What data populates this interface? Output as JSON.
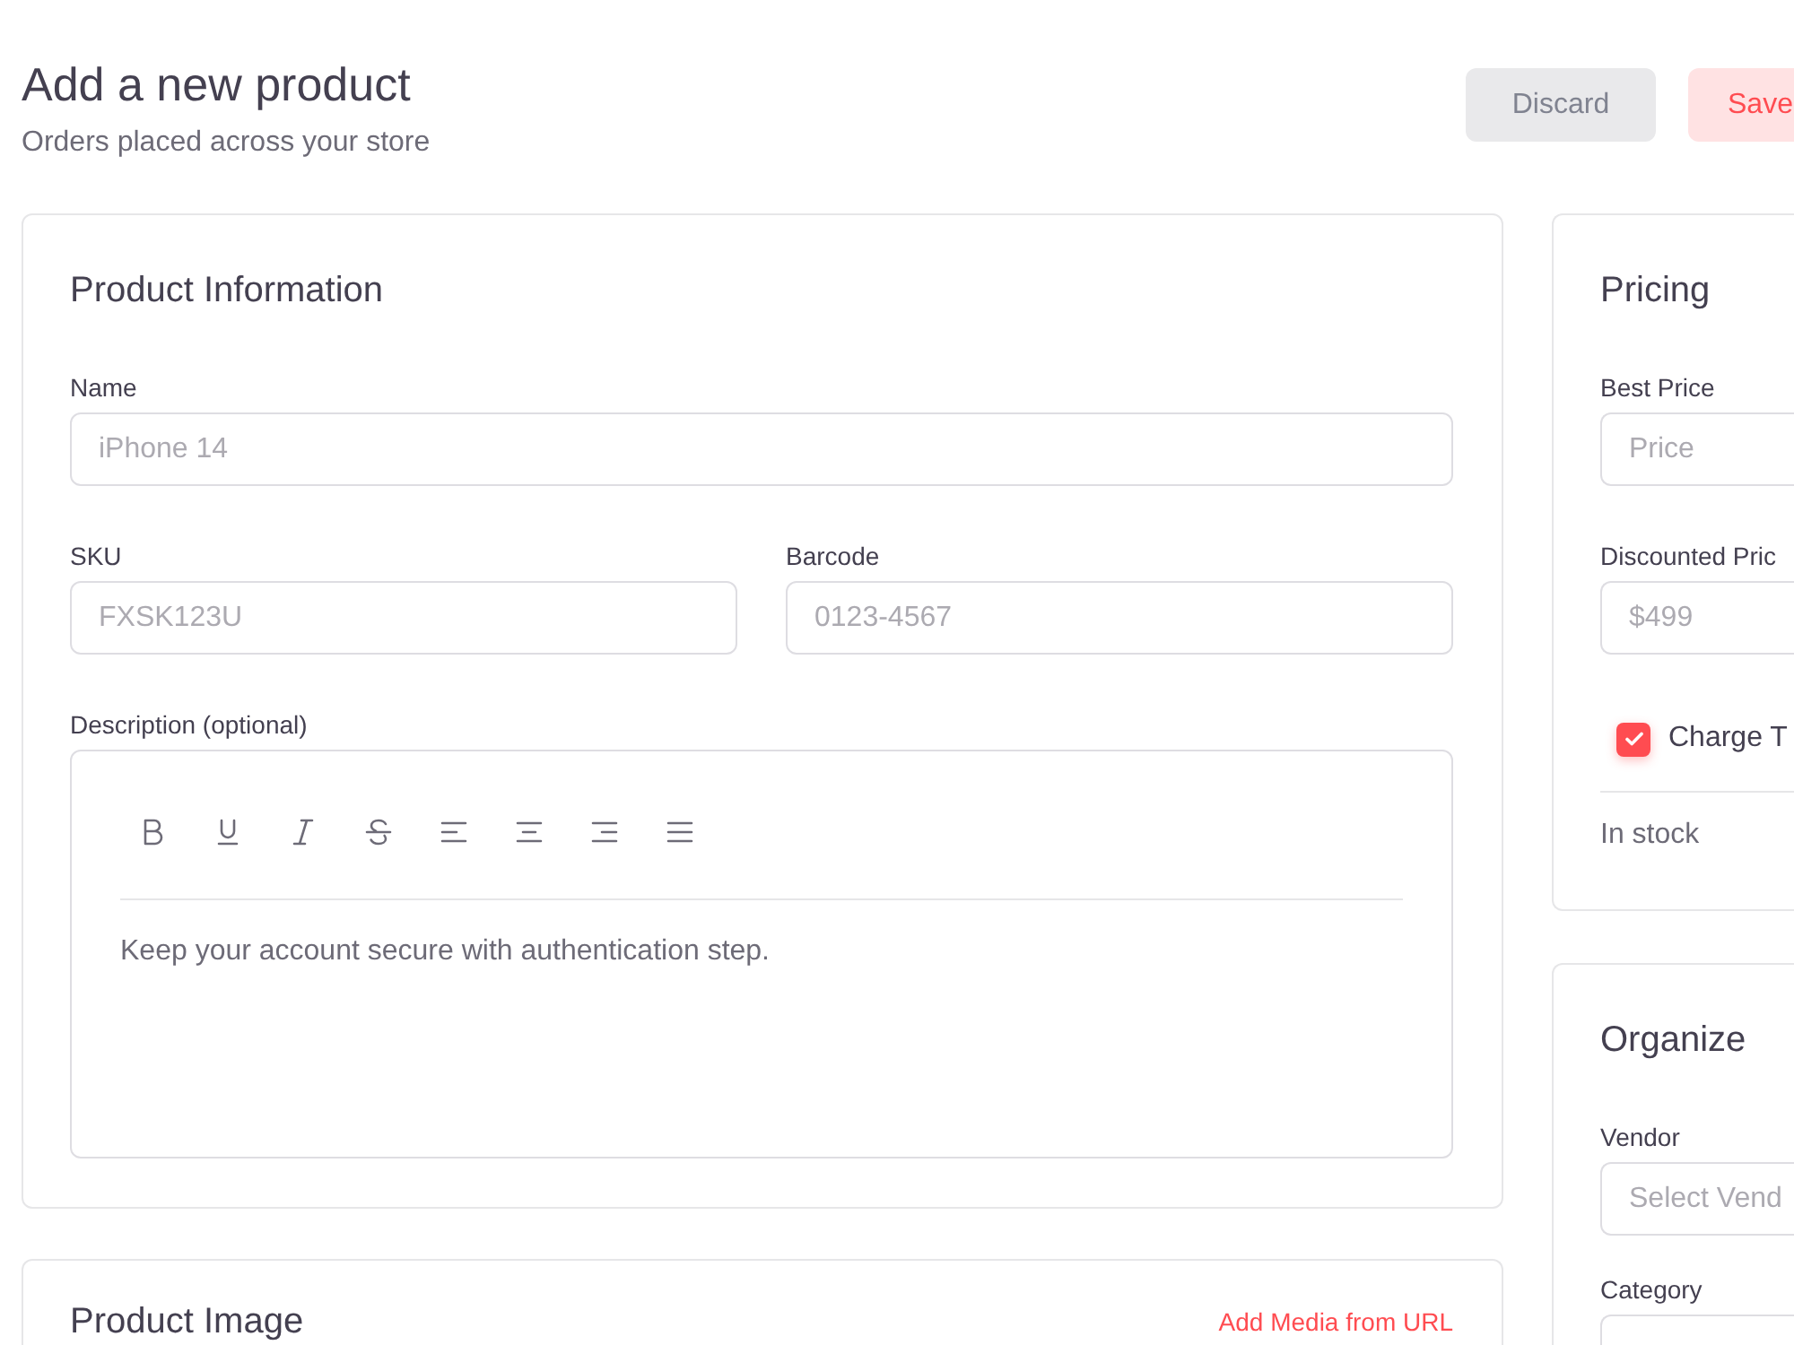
{
  "header": {
    "title": "Add a new product",
    "subtitle": "Orders placed across your store",
    "buttons": [
      {
        "label": "Discard",
        "kind": "secondary"
      },
      {
        "label": "Save",
        "kind": "primary"
      }
    ]
  },
  "product_information": {
    "title": "Product Information",
    "name": {
      "label": "Name",
      "placeholder": "iPhone 14"
    },
    "sku": {
      "label": "SKU",
      "placeholder": "FXSK123U"
    },
    "barcode": {
      "label": "Barcode",
      "placeholder": "0123-4567"
    },
    "description": {
      "label": "Description (optional)",
      "value": "Keep your account secure with authentication step."
    }
  },
  "product_image": {
    "title": "Product Image",
    "link": "Add Media from URL"
  },
  "pricing": {
    "title": "Pricing",
    "best_price": {
      "label": "Best Price",
      "placeholder": "Price"
    },
    "discounted_price": {
      "label": "Discounted Pric",
      "placeholder": "$499"
    },
    "charge_tax": {
      "label": "Charge T",
      "checked": true
    },
    "stock": {
      "label": "In stock"
    }
  },
  "organize": {
    "title": "Organize",
    "vendor": {
      "label": "Vendor",
      "placeholder": "Select Vend"
    },
    "category": {
      "label": "Category"
    }
  }
}
